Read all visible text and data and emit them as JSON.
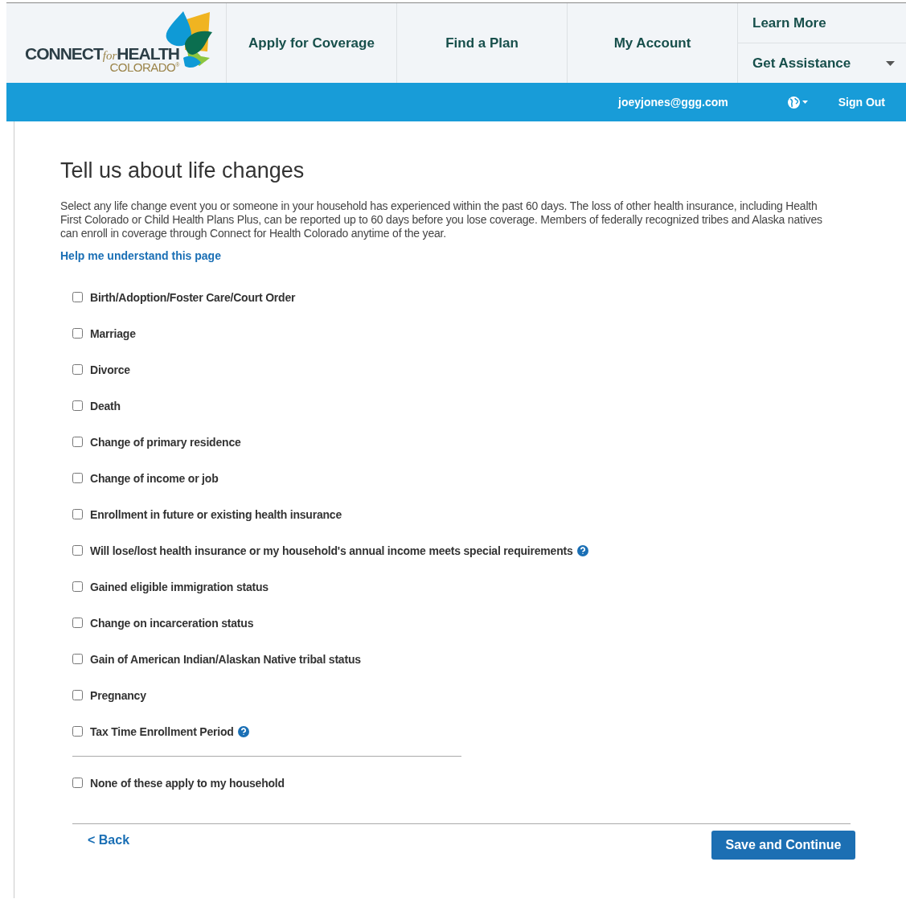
{
  "logo": {
    "connect": "CONNECT",
    "for": "for",
    "health": "HEALTH",
    "state": "COLORADO",
    "mark": "®"
  },
  "nav": [
    {
      "label": "Apply for Coverage"
    },
    {
      "label": "Find a Plan"
    },
    {
      "label": "My Account"
    }
  ],
  "nav_side": [
    {
      "label": "Learn More",
      "dropdown": false
    },
    {
      "label": "Get Assistance",
      "dropdown": true
    }
  ],
  "user_bar": {
    "email": "joeyjones@ggg.com",
    "sign_out": "Sign Out"
  },
  "page": {
    "title": "Tell us about life changes",
    "intro": "Select any life change event you or someone in your household has experienced within the past 60 days. The loss of other health insurance, including Health First Colorado or Child Health Plans Plus, can be reported up to 60 days before you lose coverage. Members of federally recognized tribes and Alaska natives can enroll in coverage through Connect for Health Colorado anytime of the year.",
    "help_link": "Help me understand this page"
  },
  "life_changes": [
    {
      "label": "Birth/Adoption/Foster Care/Court Order",
      "checked": false,
      "help": false
    },
    {
      "label": "Marriage",
      "checked": false,
      "help": false
    },
    {
      "label": "Divorce",
      "checked": false,
      "help": false
    },
    {
      "label": "Death",
      "checked": false,
      "help": false
    },
    {
      "label": "Change of primary residence",
      "checked": false,
      "help": false
    },
    {
      "label": "Change of income or job",
      "checked": false,
      "help": false
    },
    {
      "label": "Enrollment in future or existing health insurance",
      "checked": false,
      "help": false
    },
    {
      "label": "Will lose/lost health insurance or my household's annual income meets special requirements",
      "checked": false,
      "help": true
    },
    {
      "label": "Gained eligible immigration status",
      "checked": false,
      "help": false
    },
    {
      "label": "Change on incarceration status",
      "checked": false,
      "help": false
    },
    {
      "label": "Gain of American Indian/Alaskan Native tribal status",
      "checked": false,
      "help": false
    },
    {
      "label": "Pregnancy",
      "checked": false,
      "help": false
    },
    {
      "label": "Tax Time Enrollment Period",
      "checked": false,
      "help": true
    }
  ],
  "none_option": {
    "label": "None of these apply to my household",
    "checked": false
  },
  "footer": {
    "back": "< Back",
    "save": "Save and Continue"
  }
}
